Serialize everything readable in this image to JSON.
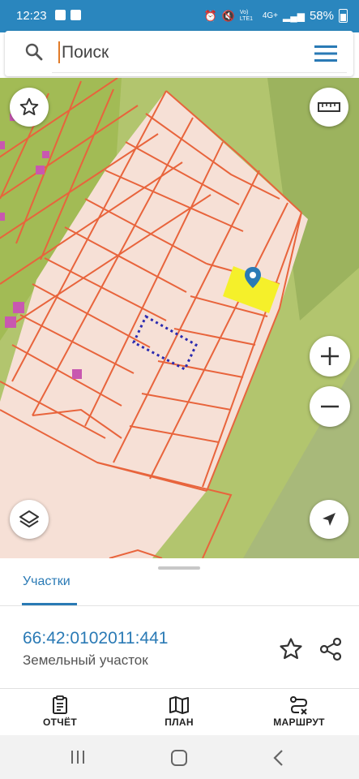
{
  "status_bar": {
    "time": "12:23",
    "network": "4G+",
    "network_sub": "Vo) LTE1",
    "battery": "58%"
  },
  "search": {
    "placeholder": "Поиск"
  },
  "bottom_panel": {
    "tab_label": "Участки",
    "cadastral_number": "66:42:0102011:441",
    "parcel_type": "Земельный участок"
  },
  "bottom_nav": {
    "items": [
      {
        "label": "ОТЧЁТ",
        "icon": "report-icon"
      },
      {
        "label": "ПЛАН",
        "icon": "map-plan-icon"
      },
      {
        "label": "МАРШРУТ",
        "icon": "route-icon"
      }
    ]
  },
  "colors": {
    "status_bar": "#2a86be",
    "accent": "#2a7ab5",
    "parcel_lines": "#e8643c",
    "selected_parcel": "#f5f02a",
    "map_green": "#b2c56e",
    "map_parcel_fill": "#f6e0d6"
  }
}
